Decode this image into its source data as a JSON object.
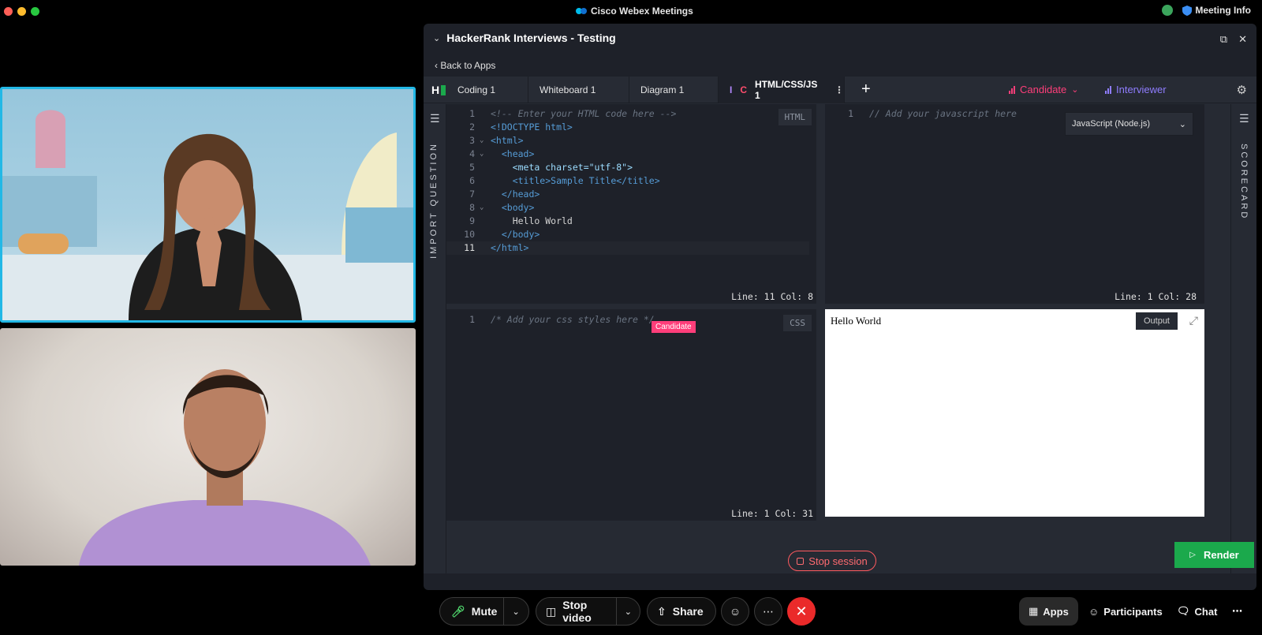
{
  "window": {
    "app_title": "Cisco Webex Meetings",
    "meeting_info": "Meeting Info"
  },
  "panel": {
    "title": "HackerRank Interviews - Testing",
    "back_label": "Back to Apps"
  },
  "tabs": [
    {
      "label": "Coding 1"
    },
    {
      "label": "Whiteboard 1"
    },
    {
      "label": "Diagram 1"
    },
    {
      "label": "HTML/CSS/JS 1",
      "presence": [
        "I",
        "C"
      ]
    }
  ],
  "roles": {
    "candidate": "Candidate",
    "interviewer": "Interviewer"
  },
  "rails": {
    "left": "IMPORT QUESTION",
    "right": "SCORECARD"
  },
  "html_editor": {
    "lang": "HTML",
    "status": "Line: 11 Col: 8",
    "lines": [
      "<!-- Enter your HTML code here -->",
      "<!DOCTYPE html>",
      "<html>",
      "  <head>",
      "    <meta charset=\"utf-8\">",
      "    <title>Sample Title</title>",
      "  </head>",
      "  <body>",
      "    Hello World",
      "  </body>",
      "</html>"
    ]
  },
  "js_editor": {
    "lang_select": "JavaScript (Node.js)",
    "status": "Line: 1 Col: 28",
    "lines": [
      "// Add your javascript here"
    ]
  },
  "css_editor": {
    "lang": "CSS",
    "status": "Line: 1 Col: 31",
    "cursor_tag": "Candidate",
    "lines": [
      "/* Add your css styles here */"
    ]
  },
  "output": {
    "text": "Hello World",
    "label": "Output",
    "render_label": "Render"
  },
  "session": {
    "stop_label": "Stop session"
  },
  "controls": {
    "mute": "Mute",
    "stop_video": "Stop video",
    "share": "Share",
    "apps": "Apps",
    "participants": "Participants",
    "chat": "Chat"
  },
  "colors": {
    "accent_green": "#1ba94c",
    "candidate_pink": "#ff3e7a",
    "interviewer_purple": "#8f7dff",
    "active_speaker_border": "#22b8e6",
    "leave_red": "#ea2a2a"
  }
}
